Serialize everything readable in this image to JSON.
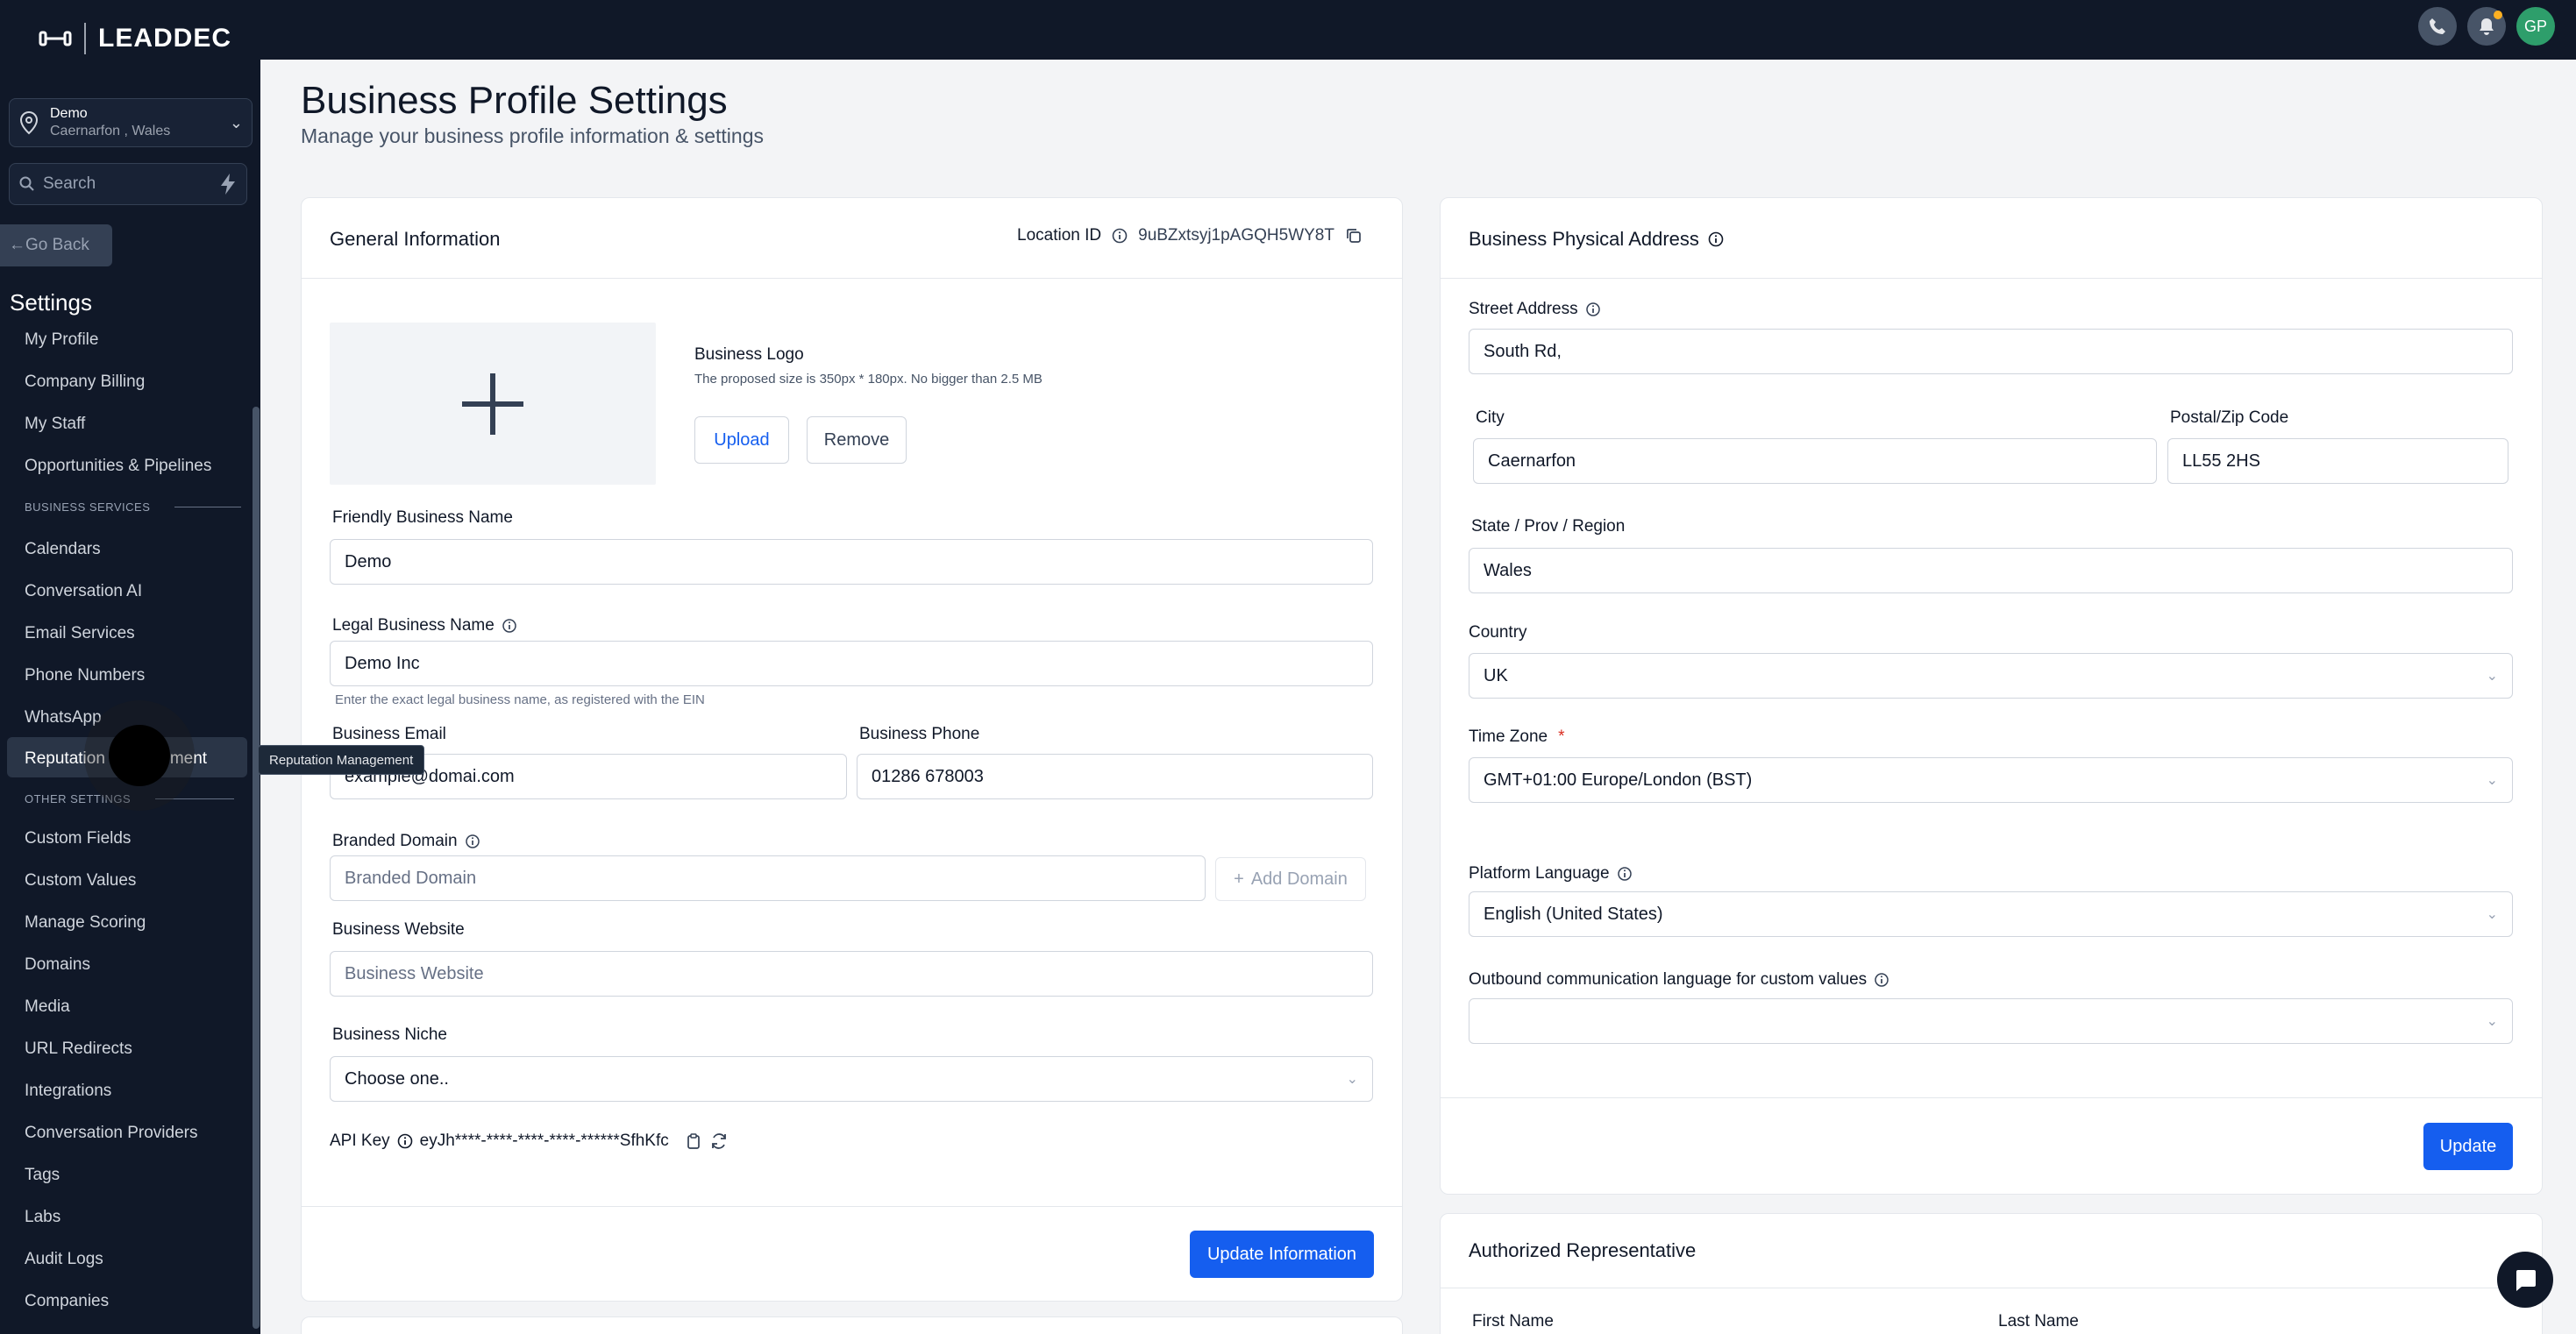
{
  "brand": {
    "name": "LEADDEC"
  },
  "location_switcher": {
    "name": "Demo",
    "address": "Caernarfon , Wales"
  },
  "search": {
    "placeholder": "Search"
  },
  "go_back": "Go Back",
  "sidebar": {
    "title": "Settings",
    "items_top": [
      "My Profile",
      "Company Billing",
      "My Staff",
      "Opportunities & Pipelines"
    ],
    "section_business": "BUSINESS SERVICES",
    "items_business": [
      "Calendars",
      "Conversation AI",
      "Email Services",
      "Phone Numbers",
      "WhatsApp",
      "Reputation Management"
    ],
    "section_other": "OTHER SETTINGS",
    "items_other": [
      "Custom Fields",
      "Custom Values",
      "Manage Scoring",
      "Domains",
      "Media",
      "URL Redirects",
      "Integrations",
      "Conversation Providers",
      "Tags",
      "Labs",
      "Audit Logs",
      "Companies"
    ],
    "tooltip": "Reputation Management"
  },
  "topbar": {
    "avatar_initials": "GP"
  },
  "page": {
    "title": "Business Profile Settings",
    "subtitle": "Manage your business profile information & settings"
  },
  "general": {
    "title": "General Information",
    "location_id_label": "Location ID",
    "location_id": "9uBZxtsyj1pAGQH5WY8T",
    "logo_label": "Business Logo",
    "logo_hint": "The proposed size is 350px * 180px. No bigger than 2.5 MB",
    "upload": "Upload",
    "remove": "Remove",
    "friendly_label": "Friendly Business Name",
    "friendly_value": "Demo",
    "legal_label": "Legal Business Name",
    "legal_value": "Demo Inc",
    "legal_hint": "Enter the exact legal business name, as registered with the EIN",
    "email_label": "Business Email",
    "email_value": "example@domai.com",
    "phone_label": "Business Phone",
    "phone_value": "01286 678003",
    "domain_label": "Branded Domain",
    "domain_placeholder": "Branded Domain",
    "add_domain": "Add Domain",
    "website_label": "Business Website",
    "website_placeholder": "Business Website",
    "niche_label": "Business Niche",
    "niche_value": "Choose one..",
    "api_label": "API Key",
    "api_value": "eyJh****-****-****-****-******SfhKfc",
    "update": "Update Information"
  },
  "address": {
    "title": "Business Physical Address",
    "street_label": "Street Address",
    "street_value": "South Rd,",
    "city_label": "City",
    "city_value": "Caernarfon",
    "zip_label": "Postal/Zip Code",
    "zip_value": "LL55 2HS",
    "state_label": "State / Prov / Region",
    "state_value": "Wales",
    "country_label": "Country",
    "country_value": "UK",
    "tz_label": "Time Zone",
    "tz_required": "*",
    "tz_value": "GMT+01:00 Europe/London (BST)",
    "lang_label": "Platform Language",
    "lang_value": "English (United States)",
    "outbound_label": "Outbound communication language for custom values",
    "outbound_value": "",
    "update": "Update"
  },
  "representative": {
    "title": "Authorized Representative",
    "first_name_label": "First Name",
    "last_name_label": "Last Name"
  }
}
